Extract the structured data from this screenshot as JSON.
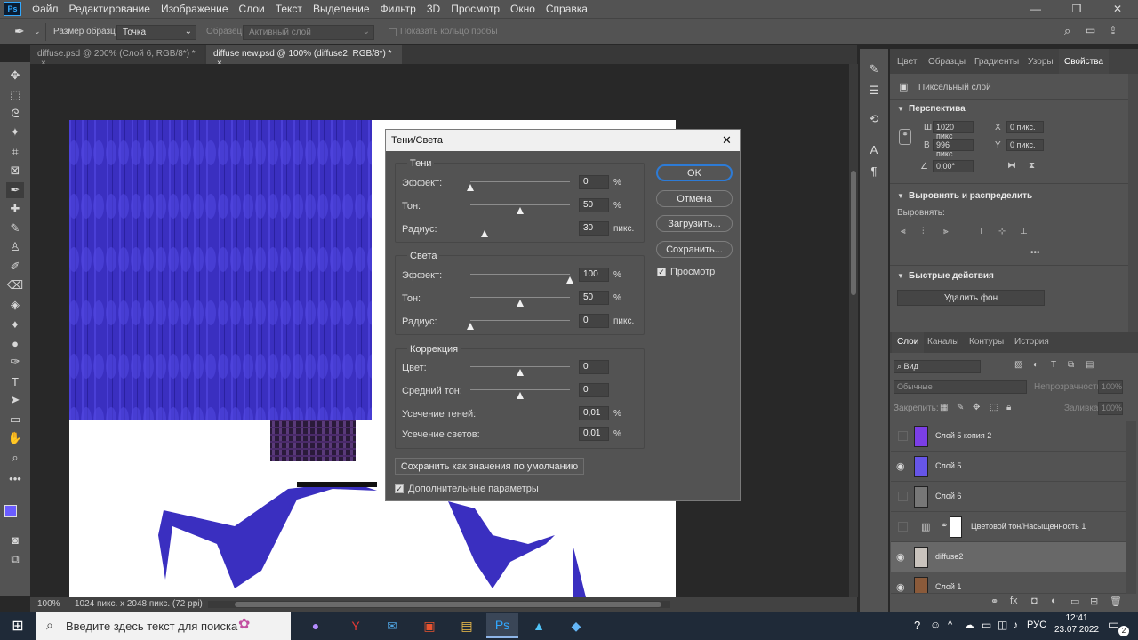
{
  "app": {
    "logo": "Ps",
    "menu": [
      "Файл",
      "Редактирование",
      "Изображение",
      "Слои",
      "Текст",
      "Выделение",
      "Фильтр",
      "3D",
      "Просмотр",
      "Окно",
      "Справка"
    ],
    "window_controls": [
      "—",
      "❐",
      "✕"
    ]
  },
  "options_bar": {
    "sample_size_label": "Размер образца:",
    "sample_size_value": "Точка",
    "sample_label": "Образец:",
    "sample_value": "Активный слой",
    "show_ring_label": "Показать кольцо пробы"
  },
  "doc_tabs": [
    {
      "label": "diffuse.psd @ 200% (Слой 6, RGB/8*) *",
      "close": "×"
    },
    {
      "label": "diffuse new.psd @ 100% (diffuse2, RGB/8*) *",
      "close": "×"
    }
  ],
  "status": {
    "zoom": "100%",
    "doc_info": "1024 пикс. x 2048 пикс. (72 ppi)",
    "arrow": "›"
  },
  "dialog": {
    "title": "Тени/Света",
    "close": "✕",
    "shadows": {
      "group": "Тени",
      "amount_label": "Эффект:",
      "amount": "0",
      "amount_unit": "%",
      "amount_pos": 0,
      "tone_label": "Тон:",
      "tone": "50",
      "tone_unit": "%",
      "tone_pos": 0.5,
      "radius_label": "Радиус:",
      "radius": "30",
      "radius_unit": "пикс.",
      "radius_pos": 0.14
    },
    "highlights": {
      "group": "Света",
      "amount_label": "Эффект:",
      "amount": "100",
      "amount_unit": "%",
      "amount_pos": 1,
      "tone_label": "Тон:",
      "tone": "50",
      "tone_unit": "%",
      "tone_pos": 0.5,
      "radius_label": "Радиус:",
      "radius": "0",
      "radius_unit": "пикс.",
      "radius_pos": 0
    },
    "adjustments": {
      "group": "Коррекция",
      "color_label": "Цвет:",
      "color": "0",
      "color_pos": 0.5,
      "midtone_label": "Средний тон:",
      "midtone": "0",
      "midtone_pos": 0.5,
      "black_clip_label": "Усечение теней:",
      "black_clip": "0,01",
      "black_clip_unit": "%",
      "white_clip_label": "Усечение светов:",
      "white_clip": "0,01",
      "white_clip_unit": "%"
    },
    "buttons": {
      "ok": "OK",
      "cancel": "Отмена",
      "load": "Загрузить...",
      "save": "Сохранить..."
    },
    "preview_label": "Просмотр",
    "save_defaults": "Сохранить как значения по умолчанию",
    "more_options_label": "Дополнительные параметры"
  },
  "properties_panel": {
    "tabs": [
      "Цвет",
      "Образцы",
      "Градиенты",
      "Узоры",
      "Свойства"
    ],
    "active_tab": 4,
    "layer_type": "Пиксельный слой",
    "transform": {
      "title": "Перспектива",
      "w_label": "Ш",
      "w": "1020 пикс",
      "h_label": "В",
      "h": "996 пикс.",
      "x_label": "X",
      "x": "0 пикс.",
      "y_label": "Y",
      "y": "0 пикс.",
      "angle": "0,00°"
    },
    "align": {
      "title": "Выровнять и распределить",
      "label": "Выровнять:",
      "more": "•••"
    },
    "quick_actions": {
      "title": "Быстрые действия",
      "remove_bg": "Удалить фон"
    }
  },
  "layers_panel": {
    "tabs": [
      "Слои",
      "Каналы",
      "Контуры",
      "История"
    ],
    "active_tab": 0,
    "search_placeholder": "Вид",
    "blend_mode": "Обычные",
    "opacity_label": "Непрозрачность:",
    "opacity": "100%",
    "lock_label": "Закрепить:",
    "fill_label": "Заливка:",
    "fill": "100%",
    "layers": [
      {
        "name": "Слой 5 копия 2",
        "visible": false,
        "thumb": "#7b3ee6",
        "selected": false
      },
      {
        "name": "Слой 5",
        "visible": true,
        "thumb": "#6655e8",
        "selected": false
      },
      {
        "name": "Слой 6",
        "visible": false,
        "thumb": "#777777",
        "selected": false
      },
      {
        "name": "Цветовой тон/Насыщенность 1",
        "visible": false,
        "thumb": "#ffffff",
        "selected": false,
        "adjustment": true
      },
      {
        "name": "diffuse2",
        "visible": true,
        "thumb": "#c9c3bd",
        "selected": true
      },
      {
        "name": "Слой 1",
        "visible": true,
        "thumb": "#8a5a3a",
        "selected": false
      }
    ]
  },
  "colors": {
    "foreground": "#6a5cff",
    "background": "#ffffff",
    "accent": "#31a8ff",
    "texture": "#3a2fc0"
  },
  "taskbar": {
    "search_placeholder": "Введите здесь текст для поиска",
    "lang": "РУС",
    "time": "12:41",
    "date": "23.07.2022",
    "notifications": "2"
  }
}
